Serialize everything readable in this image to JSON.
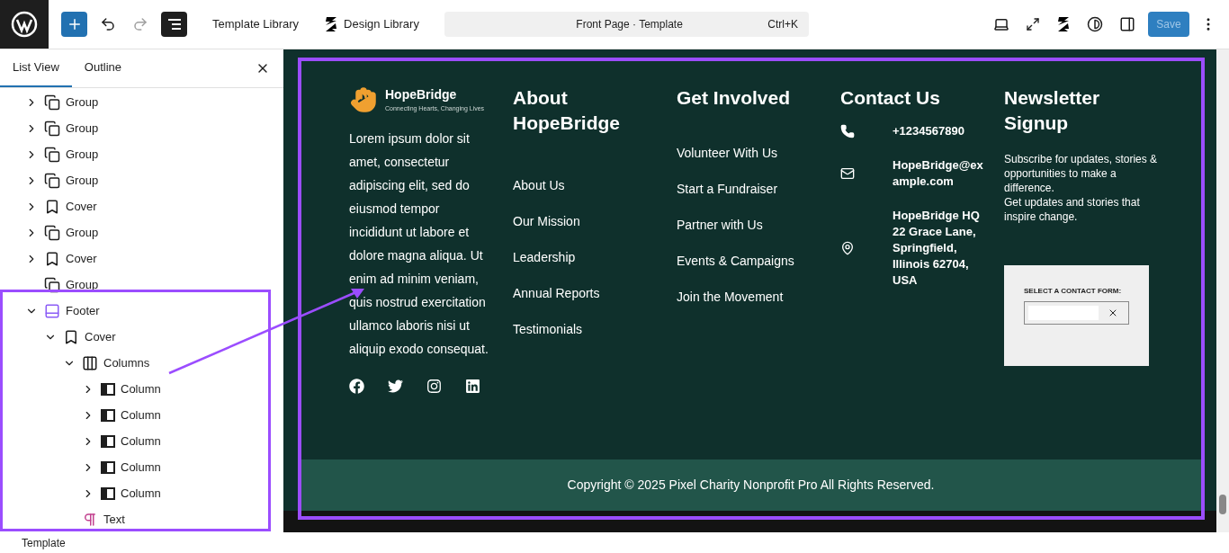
{
  "toolbar": {
    "left_links": [
      "Template Library",
      "Design Library"
    ],
    "command": {
      "title": "Front Page · Template",
      "shortcut": "Ctrl+K"
    },
    "save": {
      "label": "Save",
      "disabled": true
    }
  },
  "panel": {
    "tabs": [
      {
        "label": "List View",
        "selected": true
      },
      {
        "label": "Outline",
        "selected": false
      }
    ],
    "tree": [
      {
        "label": "Group",
        "kind": "group",
        "expanded": false
      },
      {
        "label": "Group",
        "kind": "group",
        "expanded": false
      },
      {
        "label": "Group",
        "kind": "group",
        "expanded": false
      },
      {
        "label": "Group",
        "kind": "group",
        "expanded": false
      },
      {
        "label": "Cover",
        "kind": "cover",
        "expanded": false
      },
      {
        "label": "Group",
        "kind": "group",
        "expanded": false
      },
      {
        "label": "Cover",
        "kind": "cover",
        "expanded": false
      },
      {
        "label": "Group",
        "kind": "group"
      },
      {
        "label": "Footer",
        "kind": "footer",
        "expanded": true,
        "children": [
          {
            "label": "Cover",
            "kind": "cover",
            "expanded": true,
            "children": [
              {
                "label": "Columns",
                "kind": "columns",
                "expanded": true,
                "children": [
                  {
                    "label": "Column",
                    "kind": "column",
                    "expanded": false
                  },
                  {
                    "label": "Column",
                    "kind": "column",
                    "expanded": false
                  },
                  {
                    "label": "Column",
                    "kind": "column",
                    "expanded": false
                  },
                  {
                    "label": "Column",
                    "kind": "column",
                    "expanded": false
                  },
                  {
                    "label": "Column",
                    "kind": "column",
                    "expanded": false
                  }
                ]
              },
              {
                "label": "Text",
                "kind": "text"
              }
            ]
          }
        ]
      }
    ],
    "breadcrumb": "Template"
  },
  "footer": {
    "brand": {
      "name": "HopeBridge",
      "tagline": "Connecting Hearts, Changing Lives"
    },
    "about_text": "Lorem ipsum dolor sit amet, consectetur adipiscing elit, sed do eiusmod tempor incididunt ut labore et dolore magna aliqua. Ut enim ad minim veniam, quis nostrud exercitation ullamco laboris nisi ut aliquip exodo consequat.",
    "socials": [
      {
        "kind": "facebook"
      },
      {
        "kind": "twitter"
      },
      {
        "kind": "instagram"
      },
      {
        "kind": "linkedin"
      }
    ],
    "about": {
      "heading": "About HopeBridge",
      "links": [
        "About Us",
        "Our Mission",
        "Leadership",
        "Annual Reports",
        "Testimonials"
      ]
    },
    "involved": {
      "heading": "Get Involved",
      "links": [
        "Volunteer With Us",
        "Start a Fundraiser",
        "Partner with Us",
        "Events & Campaigns",
        "Join the Movement"
      ]
    },
    "contact": {
      "heading": "Contact Us",
      "items": [
        {
          "kind": "phone",
          "text": "+1234567890"
        },
        {
          "kind": "email",
          "text": "HopeBridge@example.com"
        },
        {
          "kind": "location",
          "text": "HopeBridge HQ 22 Grace Lane, Springfield, Illinois 62704, USA"
        }
      ]
    },
    "newsletter": {
      "heading": "Newsletter Signup",
      "text": "Subscribe for updates, stories & opportunities to make a difference.",
      "text_2": "Get updates and stories that inspire change.",
      "form_label": "SELECT A CONTACT FORM:"
    },
    "copyright": "Copyright © 2025 Pixel Charity Nonprofit Pro All Rights Reserved."
  }
}
